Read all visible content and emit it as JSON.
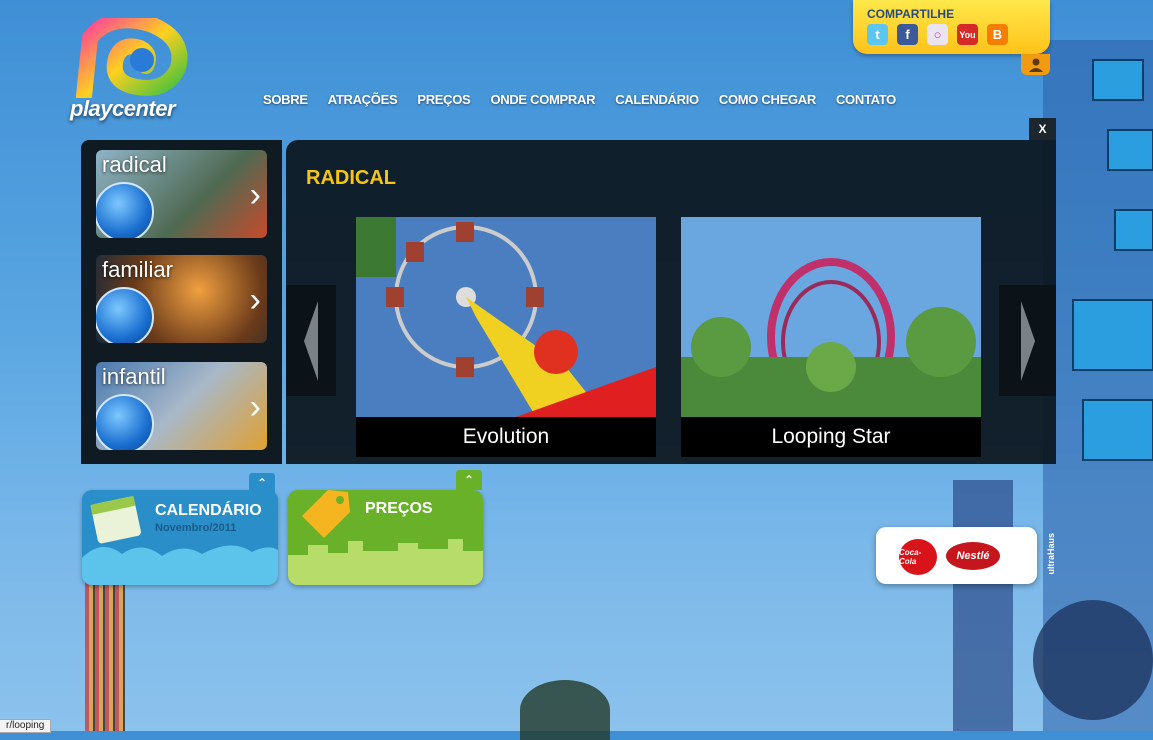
{
  "brand": {
    "name": "playcenter"
  },
  "nav": {
    "items": [
      "SOBRE",
      "ATRAÇÕES",
      "PREÇOS",
      "ONDE COMPRAR",
      "CALENDÁRIO",
      "COMO CHEGAR",
      "CONTATO"
    ]
  },
  "share": {
    "title": "COMPARTILHE",
    "icons": [
      "twitter-icon",
      "facebook-icon",
      "orkut-icon",
      "youtube-icon",
      "blogger-icon"
    ]
  },
  "categories": [
    {
      "label": "radical"
    },
    {
      "label": "familiar"
    },
    {
      "label": "infantil"
    }
  ],
  "carousel": {
    "close_label": "X",
    "title": "RADICAL",
    "slides": [
      {
        "caption": "Evolution"
      },
      {
        "caption": "Looping Star"
      }
    ]
  },
  "cards": {
    "calendar": {
      "title": "CALENDÁRIO",
      "subtitle": "Novembro/2011"
    },
    "prices": {
      "title": "PREÇOS"
    }
  },
  "sponsors": {
    "coke": "Coca-Cola",
    "nestle": "Nestlé"
  },
  "credit": "ultraHaus",
  "status": {
    "url": "r/looping"
  },
  "colors": {
    "accent": "#f6c516",
    "panel": "#0f1a22",
    "calendar": "#2a8fc8",
    "prices": "#6ab12a"
  }
}
